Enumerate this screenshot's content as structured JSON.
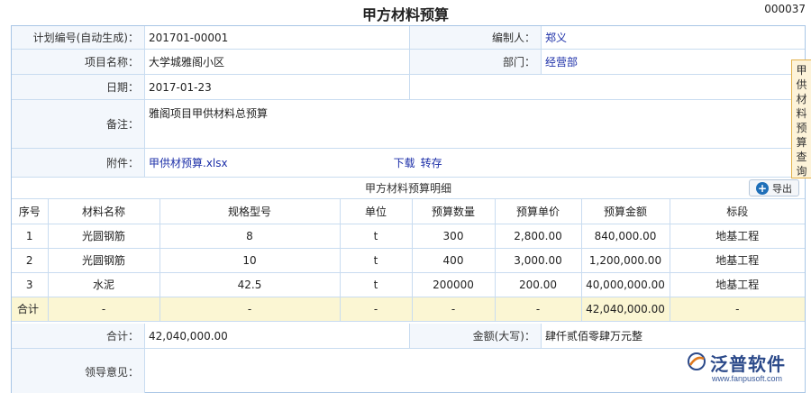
{
  "header": {
    "title": "甲方材料预算",
    "doc_no": "000037"
  },
  "form": {
    "plan_no_label": "计划编号(自动生成)：",
    "plan_no_value": "201701-00001",
    "editor_label": "编制人：",
    "editor_value": "郑义",
    "project_label": "项目名称：",
    "project_value": "大学城雅阁小区",
    "dept_label": "部门：",
    "dept_value": "经营部",
    "date_label": "日期：",
    "date_value": "2017-01-23",
    "remark_label": "备注：",
    "remark_value": "雅阁项目甲供材料总预算",
    "attachment_label": "附件：",
    "attachment_file": "甲供材预算.xlsx",
    "download_label": "下载",
    "transfer_label": "转存"
  },
  "detail": {
    "section_title": "甲方材料预算明细",
    "export_label": "导出",
    "columns": [
      "序号",
      "材料名称",
      "规格型号",
      "单位",
      "预算数量",
      "预算单价",
      "预算金额",
      "标段"
    ],
    "rows": [
      [
        "1",
        "光圆钢筋",
        "8",
        "t",
        "300",
        "2,800.00",
        "840,000.00",
        "地基工程"
      ],
      [
        "2",
        "光圆钢筋",
        "10",
        "t",
        "400",
        "3,000.00",
        "1,200,000.00",
        "地基工程"
      ],
      [
        "3",
        "水泥",
        "42.5",
        "t",
        "200000",
        "200.00",
        "40,000,000.00",
        "地基工程"
      ]
    ],
    "total_row": [
      "合计",
      "-",
      "-",
      "-",
      "-",
      "-",
      "42,040,000.00",
      "-"
    ]
  },
  "summary": {
    "total_label": "合计：",
    "total_value": "42,040,000.00",
    "amount_upper_label": "金额(大写)：",
    "amount_upper_value": "肆仟贰佰零肆万元整",
    "opinion_label": "领导意见："
  },
  "side_tab": {
    "label": "甲供材料预算查询"
  },
  "watermark": {
    "brand": "泛普软件",
    "url": "www.fanpusoft.com"
  },
  "colors": {
    "border": "#c9dcf0",
    "label_bg": "#f3f7fc",
    "total_row_bg": "#fbf6d3",
    "link": "#1c2fa8",
    "side_tab_bg": "#fdf3d9"
  }
}
